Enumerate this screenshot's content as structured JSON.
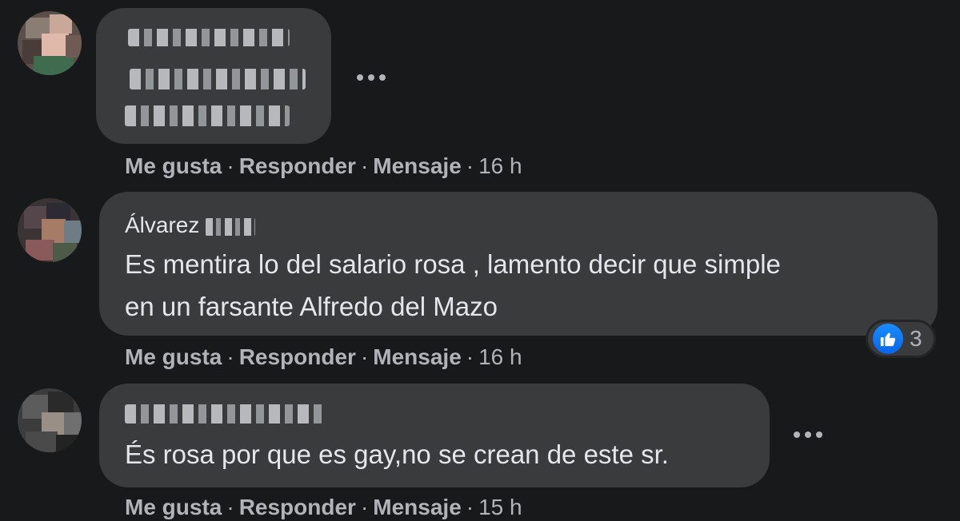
{
  "comments": [
    {
      "author": "",
      "text": "",
      "actions": {
        "like": "Me gusta",
        "reply": "Responder",
        "message": "Mensaje"
      },
      "time": "16 h"
    },
    {
      "author": "Álvarez",
      "text_lines": [
        "Es mentira lo del salario rosa , lamento decir que simple",
        "en un farsante Alfredo del Mazo"
      ],
      "actions": {
        "like": "Me gusta",
        "reply": "Responder",
        "message": "Mensaje"
      },
      "time": "16 h",
      "reaction": {
        "icon": "thumbs-up-icon",
        "count": "3"
      }
    },
    {
      "author": "",
      "text": "És rosa por que es gay,no se crean de este sr.",
      "actions": {
        "like": "Me gusta",
        "reply": "Responder",
        "message": "Mensaje"
      },
      "time": "15 h"
    }
  ],
  "separator": "·",
  "colors": {
    "background": "#18191a",
    "bubble": "#3a3b3c",
    "text": "#e4e6eb",
    "muted": "#b0b3b8",
    "like_blue": "#0866e8"
  }
}
